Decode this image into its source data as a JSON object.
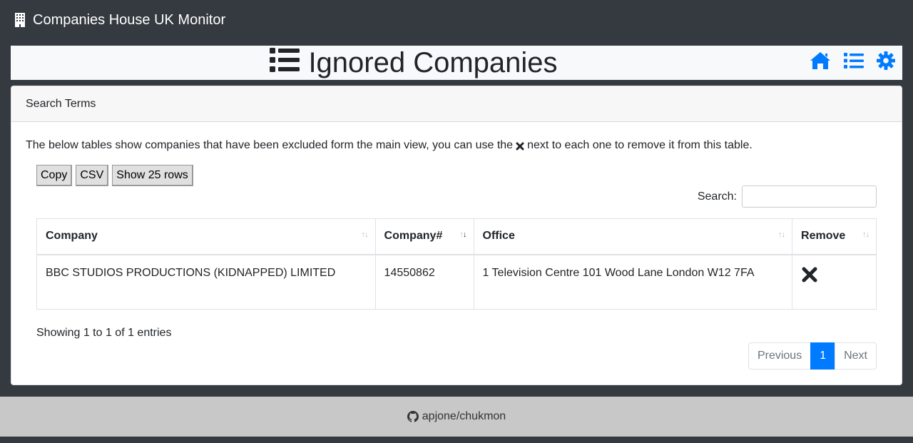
{
  "navbar": {
    "brand": "Companies House UK Monitor",
    "brand_icon": "building-icon"
  },
  "header": {
    "title": "Ignored Companies",
    "title_icon": "list-icon",
    "actions": [
      {
        "icon": "home-icon"
      },
      {
        "icon": "list-icon"
      },
      {
        "icon": "gear-icon"
      }
    ],
    "accent": "#007bff"
  },
  "card": {
    "header": "Search Terms",
    "intro_before": "The below tables show companies that have been excluded form the main view, you can use the",
    "intro_after": "next to each one to remove it from this table."
  },
  "toolbar": {
    "copy": "Copy",
    "csv": "CSV",
    "rows": "Show 25 rows"
  },
  "search": {
    "label": "Search:",
    "value": "",
    "placeholder": ""
  },
  "table": {
    "columns": [
      "Company",
      "Company#",
      "Office",
      "Remove"
    ],
    "rows": [
      {
        "company": "BBC STUDIOS PRODUCTIONS (KIDNAPPED) LIMITED",
        "number": "14550862",
        "office": "1 Television Centre 101 Wood Lane London W12 7FA",
        "remove_icon": "close-icon"
      }
    ]
  },
  "info": "Showing 1 to 1 of 1 entries",
  "pagination": {
    "previous": "Previous",
    "current": "1",
    "next": "Next"
  },
  "footer": {
    "text": "apjone/chukmon",
    "icon": "github-icon"
  }
}
